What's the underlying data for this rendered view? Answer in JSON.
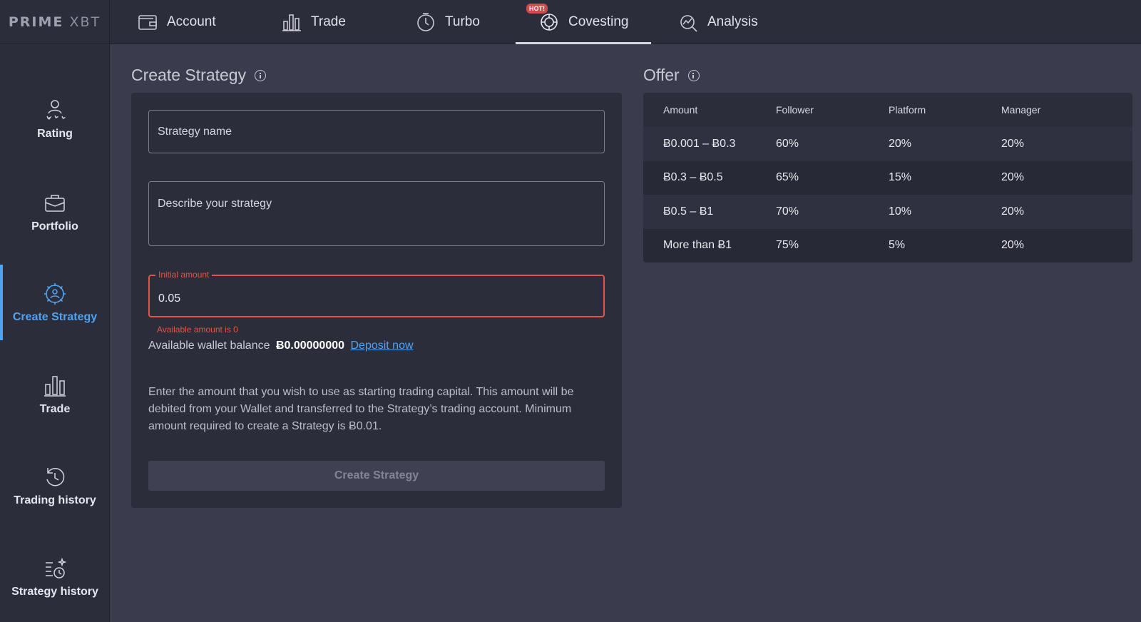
{
  "topbar": {
    "logo": {
      "bold": "PRIME",
      "light": "XBT"
    },
    "tabs": [
      {
        "label": "Account",
        "icon": "wallet-icon"
      },
      {
        "label": "Trade",
        "icon": "bar-chart-icon"
      },
      {
        "label": "Turbo",
        "icon": "timer-icon"
      },
      {
        "label": "Covesting",
        "icon": "covesting-icon",
        "badge": "HOT!",
        "active": true
      },
      {
        "label": "Analysis",
        "icon": "analysis-icon"
      }
    ]
  },
  "sidebar": {
    "items": [
      {
        "label": "Rating",
        "icon": "rating-icon"
      },
      {
        "label": "Portfolio",
        "icon": "briefcase-icon"
      },
      {
        "label": "Create Strategy",
        "icon": "gear-user-icon",
        "active": true
      },
      {
        "label": "Trade",
        "icon": "bar-chart-icon"
      },
      {
        "label": "Trading history",
        "icon": "history-icon"
      },
      {
        "label": "Strategy history",
        "icon": "strategy-history-icon"
      }
    ]
  },
  "create": {
    "title": "Create Strategy",
    "name_placeholder": "Strategy name",
    "desc_placeholder": "Describe your strategy",
    "amount_label": "Initial amount",
    "amount_value": "0.05",
    "error": "Available amount is 0",
    "wallet_label": "Available wallet balance",
    "wallet_value": "Ƀ0.00000000",
    "deposit_link": "Deposit now",
    "note": "Enter the amount that you wish to use as starting trading capital. This amount will be debited from your Wallet and transferred to the Strategy’s trading account. Minimum amount required to create a Strategy is Ƀ0.01.",
    "button": "Create Strategy"
  },
  "offer": {
    "title": "Offer",
    "headers": [
      "Amount",
      "Follower",
      "Platform",
      "Manager"
    ],
    "rows": [
      [
        "Ƀ0.001 – Ƀ0.3",
        "60%",
        "20%",
        "20%"
      ],
      [
        "Ƀ0.3 – Ƀ0.5",
        "65%",
        "15%",
        "20%"
      ],
      [
        "Ƀ0.5 – Ƀ1",
        "70%",
        "10%",
        "20%"
      ],
      [
        "More than Ƀ1",
        "75%",
        "5%",
        "20%"
      ]
    ]
  }
}
